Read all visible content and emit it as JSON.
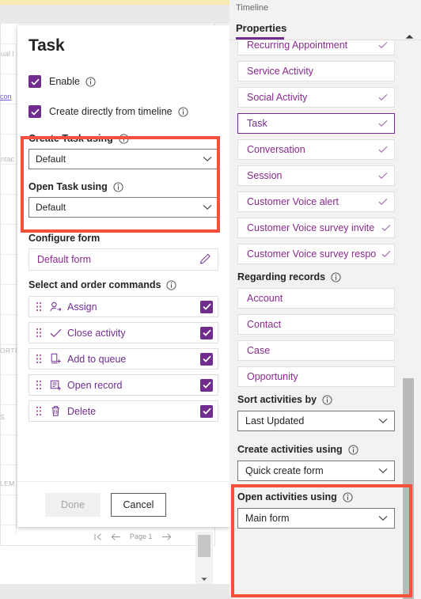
{
  "background": {
    "labels": [
      "ual l",
      "ntac",
      "ORTI",
      "S",
      "LEM"
    ],
    "link": "con",
    "pager": {
      "label": "Page 1",
      "first_icon": "first-page-icon",
      "prev_icon": "previous-page-icon",
      "next_icon": "next-page-icon"
    }
  },
  "dialog": {
    "title": "Task",
    "checkboxes": [
      {
        "label": "Enable",
        "checked": true,
        "info_icon": "info-icon"
      },
      {
        "label": "Create directly from timeline",
        "checked": true,
        "info_icon": "info-icon"
      }
    ],
    "create_task": {
      "label": "Create Task using",
      "value": "Default",
      "info_icon": "info-icon",
      "chevron": "chevron-down-icon"
    },
    "open_task": {
      "label": "Open Task using",
      "value": "Default",
      "info_icon": "info-icon",
      "chevron": "chevron-down-icon"
    },
    "configure_form": {
      "label": "Configure form",
      "value": "Default form",
      "edit_icon": "pencil-icon"
    },
    "commands_label": "Select and order commands",
    "commands": [
      {
        "label": "Assign",
        "icon": "assign-person-icon",
        "checked": true
      },
      {
        "label": "Close activity",
        "icon": "checkmark-icon",
        "checked": true
      },
      {
        "label": "Add to queue",
        "icon": "add-to-queue-icon",
        "checked": true
      },
      {
        "label": "Open record",
        "icon": "open-record-icon",
        "checked": true
      },
      {
        "label": "Delete",
        "icon": "trash-icon",
        "checked": true
      }
    ],
    "done_label": "Done",
    "cancel_label": "Cancel"
  },
  "panel": {
    "breadcrumb": "Timeline",
    "tab": "Properties",
    "activities": [
      {
        "label": "Recurring Appointment",
        "checked": true,
        "selected": false
      },
      {
        "label": "Service Activity",
        "checked": false,
        "selected": false
      },
      {
        "label": "Social Activity",
        "checked": true,
        "selected": false
      },
      {
        "label": "Task",
        "checked": true,
        "selected": true
      },
      {
        "label": "Conversation",
        "checked": true,
        "selected": false
      },
      {
        "label": "Session",
        "checked": true,
        "selected": false
      },
      {
        "label": "Customer Voice alert",
        "checked": true,
        "selected": false
      },
      {
        "label": "Customer Voice survey invite",
        "checked": true,
        "selected": false
      },
      {
        "label": "Customer Voice survey respo",
        "checked": true,
        "selected": false
      }
    ],
    "regarding_label": "Regarding records",
    "regarding": [
      {
        "label": "Account"
      },
      {
        "label": "Contact"
      },
      {
        "label": "Case"
      },
      {
        "label": "Opportunity"
      }
    ],
    "sort_by": {
      "label": "Sort activities by",
      "value": "Last Updated",
      "info_icon": "info-icon",
      "chevron": "chevron-down-icon"
    },
    "create_activities": {
      "label": "Create activities using",
      "value": "Quick create form",
      "info_icon": "info-icon",
      "chevron": "chevron-down-icon"
    },
    "open_activities": {
      "label": "Open activities using",
      "value": "Main form",
      "info_icon": "info-icon",
      "chevron": "chevron-down-icon"
    },
    "scroll_up_icon": "scroll-up-arrow-icon"
  },
  "colors": {
    "accent": "#702d8f",
    "link": "#8b2a8f",
    "highlight": "#f5503c",
    "panel_bg": "#f3f2f1"
  }
}
